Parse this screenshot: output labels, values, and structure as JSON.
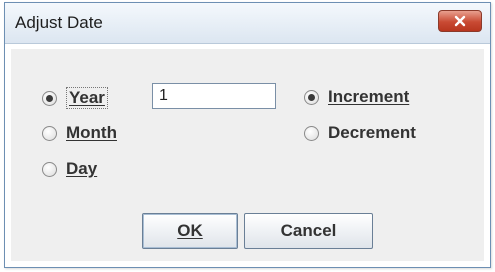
{
  "window": {
    "title": "Adjust Date"
  },
  "unit_options": [
    {
      "label": "Year",
      "checked": true
    },
    {
      "label": "Month",
      "checked": false
    },
    {
      "label": "Day",
      "checked": false
    }
  ],
  "amount": {
    "value": "1"
  },
  "direction_options": [
    {
      "label": "Increment",
      "checked": true
    },
    {
      "label": "Decrement",
      "checked": false
    }
  ],
  "buttons": {
    "ok_label": "OK",
    "cancel_label": "Cancel"
  },
  "colors": {
    "close_button": "#c94a33",
    "dialog_background": "#efefef",
    "title_bar": "#dce6f1"
  },
  "icons": {
    "close": "close-icon"
  }
}
